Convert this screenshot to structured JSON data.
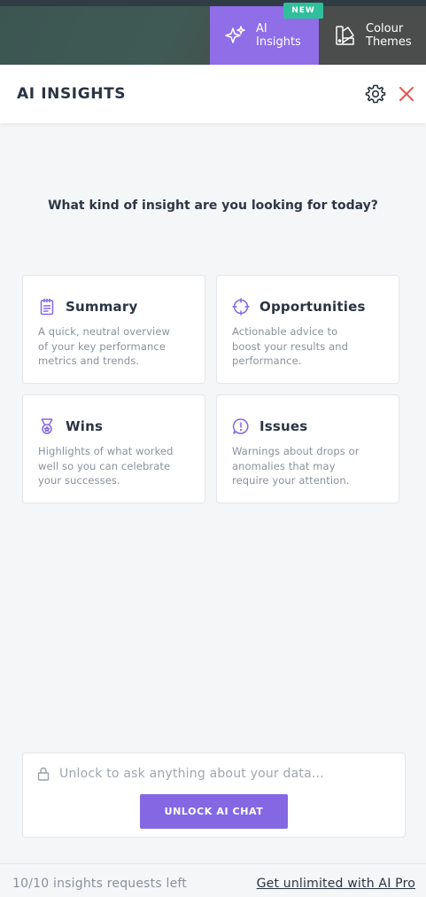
{
  "tabs": [
    {
      "label_line1": "AI",
      "label_line2": "Insights",
      "icon": "sparkle-icon",
      "badge": "NEW",
      "active": true
    },
    {
      "label_line1": "Colour",
      "label_line2": "Themes",
      "icon": "palette-icon",
      "active": false
    }
  ],
  "header": {
    "title": "AI INSIGHTS"
  },
  "question": "What kind of insight are you looking for today?",
  "cards": [
    {
      "title": "Summary",
      "desc_lines": [
        "A quick, neutral overview",
        "of your key performance",
        "metrics and trends."
      ],
      "icon": "clipboard-icon"
    },
    {
      "title": "Opportunities",
      "desc_lines": [
        "Actionable advice to",
        "boost your results and",
        "performance."
      ],
      "icon": "crosshair-icon"
    },
    {
      "title": "Wins",
      "desc_lines": [
        "Highlights of what worked",
        "well so you can celebrate",
        "your successes."
      ],
      "icon": "medal-icon"
    },
    {
      "title": "Issues",
      "desc_lines": [
        "Warnings about drops or",
        "anomalies that may",
        "require your attention."
      ],
      "icon": "alert-chat-icon"
    }
  ],
  "chat": {
    "placeholder": "Unlock to ask anything about your data...",
    "button": "UNLOCK AI CHAT"
  },
  "footer": {
    "requests_left": "10/10 insights requests left",
    "upgrade_link": "Get unlimited with AI Pro"
  },
  "colors": {
    "accent": "#8468e3",
    "badge": "#2fbf9c",
    "close": "#e0574f"
  }
}
